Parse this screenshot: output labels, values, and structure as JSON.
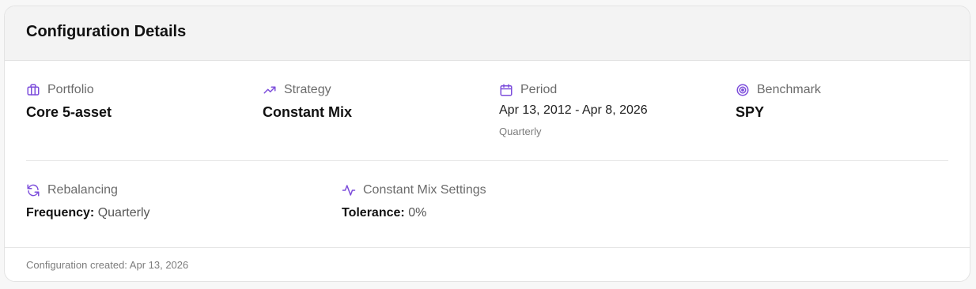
{
  "header": {
    "title": "Configuration Details"
  },
  "details": {
    "portfolio": {
      "icon": "briefcase-icon",
      "label": "Portfolio",
      "value": "Core 5-asset"
    },
    "strategy": {
      "icon": "trending-up-icon",
      "label": "Strategy",
      "value": "Constant Mix"
    },
    "period": {
      "icon": "calendar-icon",
      "label": "Period",
      "value": "Apr 13, 2012 - Apr 8, 2026",
      "sub": "Quarterly"
    },
    "benchmark": {
      "icon": "target-icon",
      "label": "Benchmark",
      "value": "SPY"
    }
  },
  "rebalancing": {
    "icon": "refresh-icon",
    "label": "Rebalancing",
    "key": "Frequency:",
    "value": "Quarterly"
  },
  "constant_mix": {
    "icon": "activity-icon",
    "label": "Constant Mix Settings",
    "key": "Tolerance:",
    "value": "0%"
  },
  "footer": {
    "text": "Configuration created: Apr 13, 2026"
  },
  "colors": {
    "accent": "#7c4ddb",
    "header_bg": "#f3f3f3",
    "border": "#e3e3e3"
  }
}
